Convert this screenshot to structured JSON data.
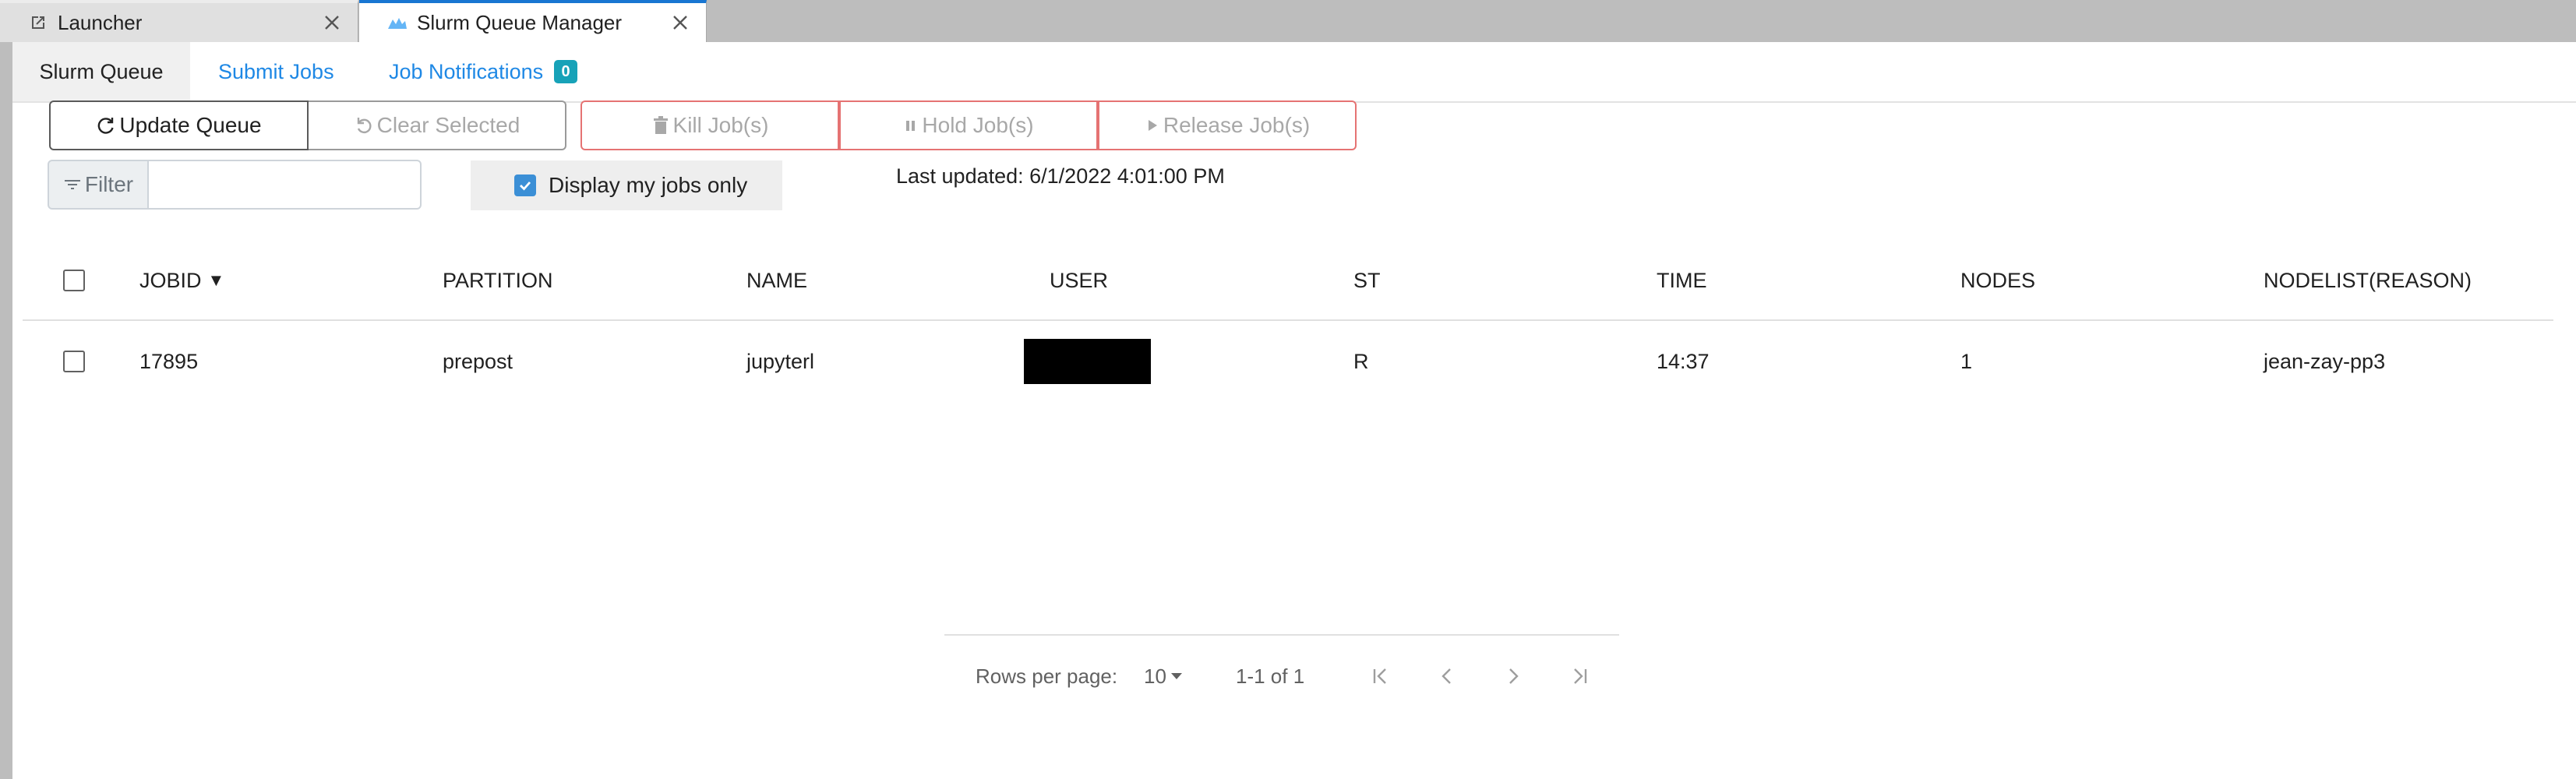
{
  "tabs": [
    {
      "label": "Launcher",
      "icon": "launch-icon"
    },
    {
      "label": "Slurm Queue Manager",
      "icon": "slurm-icon"
    }
  ],
  "subnav": {
    "queue": "Slurm Queue",
    "submit": "Submit Jobs",
    "notifications": "Job Notifications",
    "notification_count": "0"
  },
  "toolbar": {
    "update": "Update Queue",
    "clear": "Clear Selected",
    "kill": "Kill Job(s)",
    "hold": "Hold Job(s)",
    "release": "Release Job(s)"
  },
  "filter": {
    "label": "Filter",
    "value": "",
    "placeholder": ""
  },
  "my_jobs": {
    "label": "Display my jobs only",
    "checked": true
  },
  "last_updated": "Last updated: 6/1/2022 4:01:00 PM",
  "table": {
    "headers": [
      "JOBID",
      "PARTITION",
      "NAME",
      "USER",
      "ST",
      "TIME",
      "NODES",
      "NODELIST(REASON)"
    ],
    "sort_indicator": "▼",
    "rows": [
      {
        "jobid": "17895",
        "partition": "prepost",
        "name": "jupyterl",
        "user": "",
        "st": "R",
        "time": "14:37",
        "nodes": "1",
        "nodelist": "jean-zay-pp3"
      }
    ]
  },
  "pagination": {
    "rows_per_page_label": "Rows per page:",
    "rows_per_page": "10",
    "range": "1-1 of 1"
  },
  "colors": {
    "accent": "#1976d2",
    "link": "#1e88e5",
    "badge": "#17a2b8",
    "danger_border": "#e57373",
    "checkbox": "#3b8fd6"
  }
}
